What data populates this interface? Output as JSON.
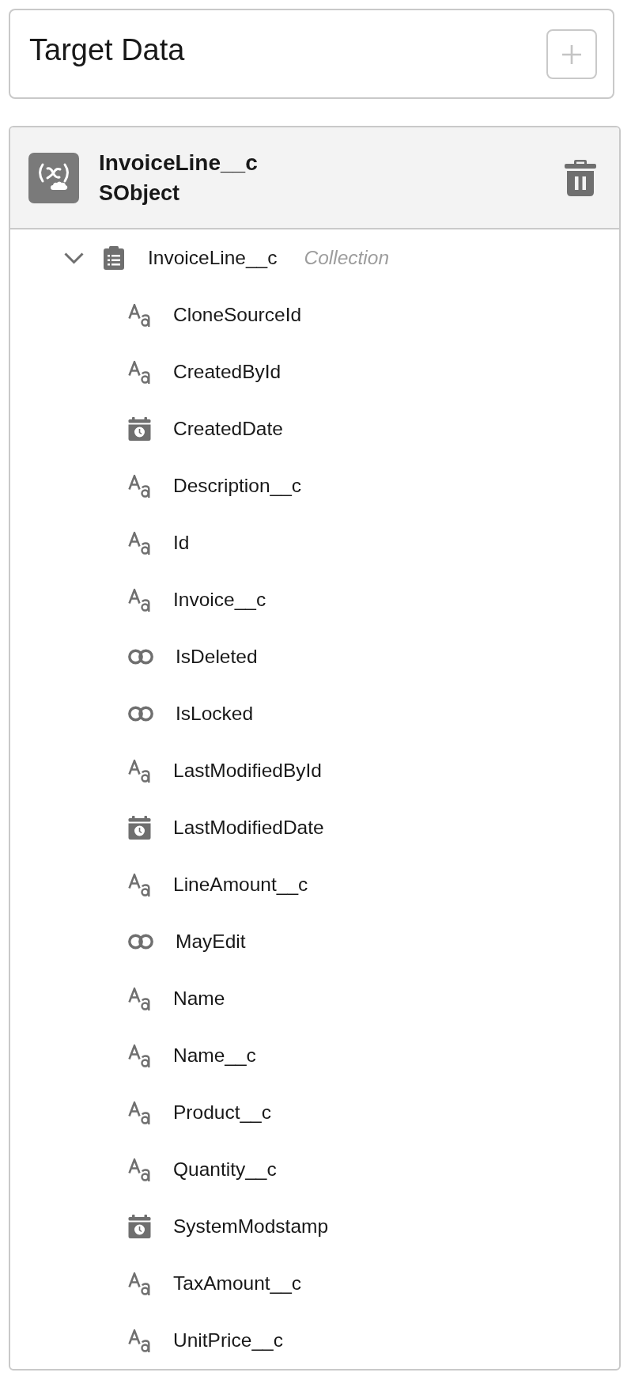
{
  "target_panel": {
    "title": "Target Data"
  },
  "variable": {
    "name": "InvoiceLine__c",
    "type": "SObject"
  },
  "tree": {
    "label": "InvoiceLine__c",
    "type_label": "Collection",
    "expanded": true,
    "children": [
      {
        "label": "CloneSourceId",
        "kind": "text"
      },
      {
        "label": "CreatedById",
        "kind": "text"
      },
      {
        "label": "CreatedDate",
        "kind": "datetime"
      },
      {
        "label": "Description__c",
        "kind": "text"
      },
      {
        "label": "Id",
        "kind": "text"
      },
      {
        "label": "Invoice__c",
        "kind": "text"
      },
      {
        "label": "IsDeleted",
        "kind": "boolean"
      },
      {
        "label": "IsLocked",
        "kind": "boolean"
      },
      {
        "label": "LastModifiedById",
        "kind": "text"
      },
      {
        "label": "LastModifiedDate",
        "kind": "datetime"
      },
      {
        "label": "LineAmount__c",
        "kind": "text"
      },
      {
        "label": "MayEdit",
        "kind": "boolean"
      },
      {
        "label": "Name",
        "kind": "text"
      },
      {
        "label": "Name__c",
        "kind": "text"
      },
      {
        "label": "Product__c",
        "kind": "text"
      },
      {
        "label": "Quantity__c",
        "kind": "text"
      },
      {
        "label": "SystemModstamp",
        "kind": "datetime"
      },
      {
        "label": "TaxAmount__c",
        "kind": "text"
      },
      {
        "label": "UnitPrice__c",
        "kind": "text"
      }
    ]
  }
}
